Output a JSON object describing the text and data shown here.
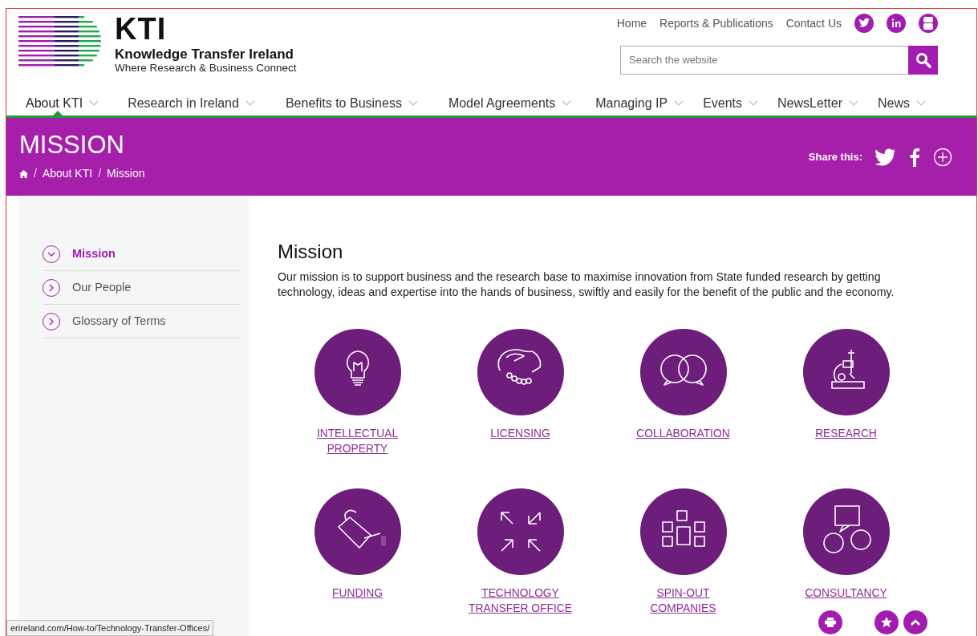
{
  "logo": {
    "title": "KTI",
    "name": "Knowledge Transfer Ireland",
    "tagline": "Where Research & Business Connect"
  },
  "top_links": [
    "Home",
    "Reports & Publications",
    "Contact Us"
  ],
  "search": {
    "placeholder": "Search the website"
  },
  "nav": [
    {
      "label": "About KTI",
      "selected": true
    },
    {
      "label": "Research in Ireland",
      "selected": false
    },
    {
      "label": "Benefits to Business",
      "selected": false
    },
    {
      "label": "Model Agreements",
      "selected": false
    },
    {
      "label": "Managing IP",
      "selected": false
    },
    {
      "label": "Events",
      "selected": false
    },
    {
      "label": "NewsLetter",
      "selected": false
    },
    {
      "label": "News",
      "selected": false
    }
  ],
  "banner": {
    "title": "MISSION",
    "breadcrumb": [
      "About KTI",
      "Mission"
    ],
    "separator": "/",
    "share_label": "Share this:"
  },
  "sidebar": [
    {
      "label": "Mission",
      "selected": true
    },
    {
      "label": "Our People",
      "selected": false
    },
    {
      "label": "Glossary of Terms",
      "selected": false
    }
  ],
  "content": {
    "heading": "Mission",
    "text": "Our mission is to support business and the research base to maximise innovation from State funded research by getting technology, ideas and expertise into the hands of business, swiftly and easily for the benefit of the public and the economy.",
    "tiles": [
      {
        "label": "INTELLECTUAL PROPERTY"
      },
      {
        "label": "LICENSING"
      },
      {
        "label": "COLLABORATION"
      },
      {
        "label": "RESEARCH"
      },
      {
        "label": "FUNDING"
      },
      {
        "label": "TECHNOLOGY TRANSFER OFFICE"
      },
      {
        "label": "SPIN-OUT COMPANIES"
      },
      {
        "label": "CONSULTANCY"
      }
    ]
  },
  "status_bar": "erireland.com/How-to/Technology-Transfer-Offices/"
}
